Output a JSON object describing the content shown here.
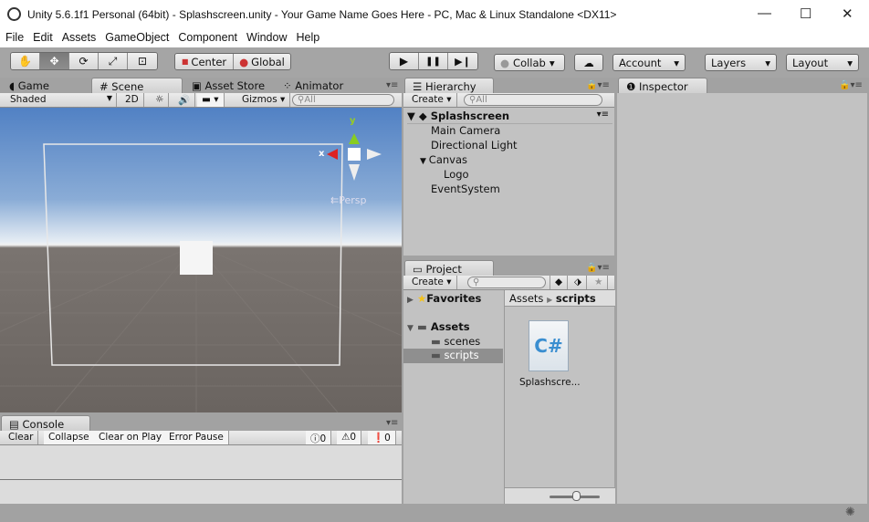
{
  "window": {
    "title": "Unity 5.6.1f1 Personal (64bit) - Splashscreen.unity - Your Game Name Goes Here - PC, Mac & Linux Standalone <DX11>",
    "minimize": "—",
    "maximize": "☐",
    "close": "✕"
  },
  "menu": [
    "File",
    "Edit",
    "Assets",
    "GameObject",
    "Component",
    "Window",
    "Help"
  ],
  "toolbar": {
    "tools": [
      "hand-tool",
      "move-tool",
      "rotate-tool",
      "scale-tool",
      "rect-tool"
    ],
    "tool_glyphs": [
      "✋",
      "✥",
      "⟳",
      "⤢",
      "⊡"
    ],
    "active_tool": "move-tool",
    "pivot": "Center",
    "space": "Global",
    "play": "▶",
    "pause": "❚❚",
    "step": "▶❙",
    "collab": "Collab",
    "cloud": "☁",
    "account": "Account",
    "layers": "Layers",
    "layout": "Layout",
    "dropdown": "▾"
  },
  "scene": {
    "tabs": [
      "Game",
      "Scene",
      "Asset Store",
      "Animator"
    ],
    "active_tab": "Scene",
    "shading": "Shaded",
    "mode2d": "2D",
    "gizmos": "Gizmos",
    "search_placeholder": "All",
    "persp": "Persp",
    "axis_x": "x",
    "axis_y": "y"
  },
  "console": {
    "tab": "Console",
    "buttons": [
      "Clear",
      "Collapse",
      "Clear on Play",
      "Error Pause"
    ],
    "info_count": "0",
    "warn_count": "0",
    "error_count": "0"
  },
  "hierarchy": {
    "tab": "Hierarchy",
    "create": "Create",
    "search_placeholder": "All",
    "scene": "Splashscreen",
    "items": [
      {
        "label": "Main Camera",
        "depth": 1
      },
      {
        "label": "Directional Light",
        "depth": 1
      },
      {
        "label": "Canvas",
        "depth": 1,
        "expanded": true
      },
      {
        "label": "Logo",
        "depth": 2
      },
      {
        "label": "EventSystem",
        "depth": 1
      }
    ]
  },
  "project": {
    "tab": "Project",
    "create": "Create",
    "favorites": "Favorites",
    "assets": "Assets",
    "folders": [
      "scenes",
      "scripts"
    ],
    "selected_folder": "scripts",
    "breadcrumb": [
      "Assets",
      "scripts"
    ],
    "files": [
      {
        "name": "Splashscre...",
        "type": "C#",
        "glyph": "C#"
      }
    ],
    "zoom_slider": 0.45
  },
  "inspector": {
    "tab": "Inspector"
  }
}
